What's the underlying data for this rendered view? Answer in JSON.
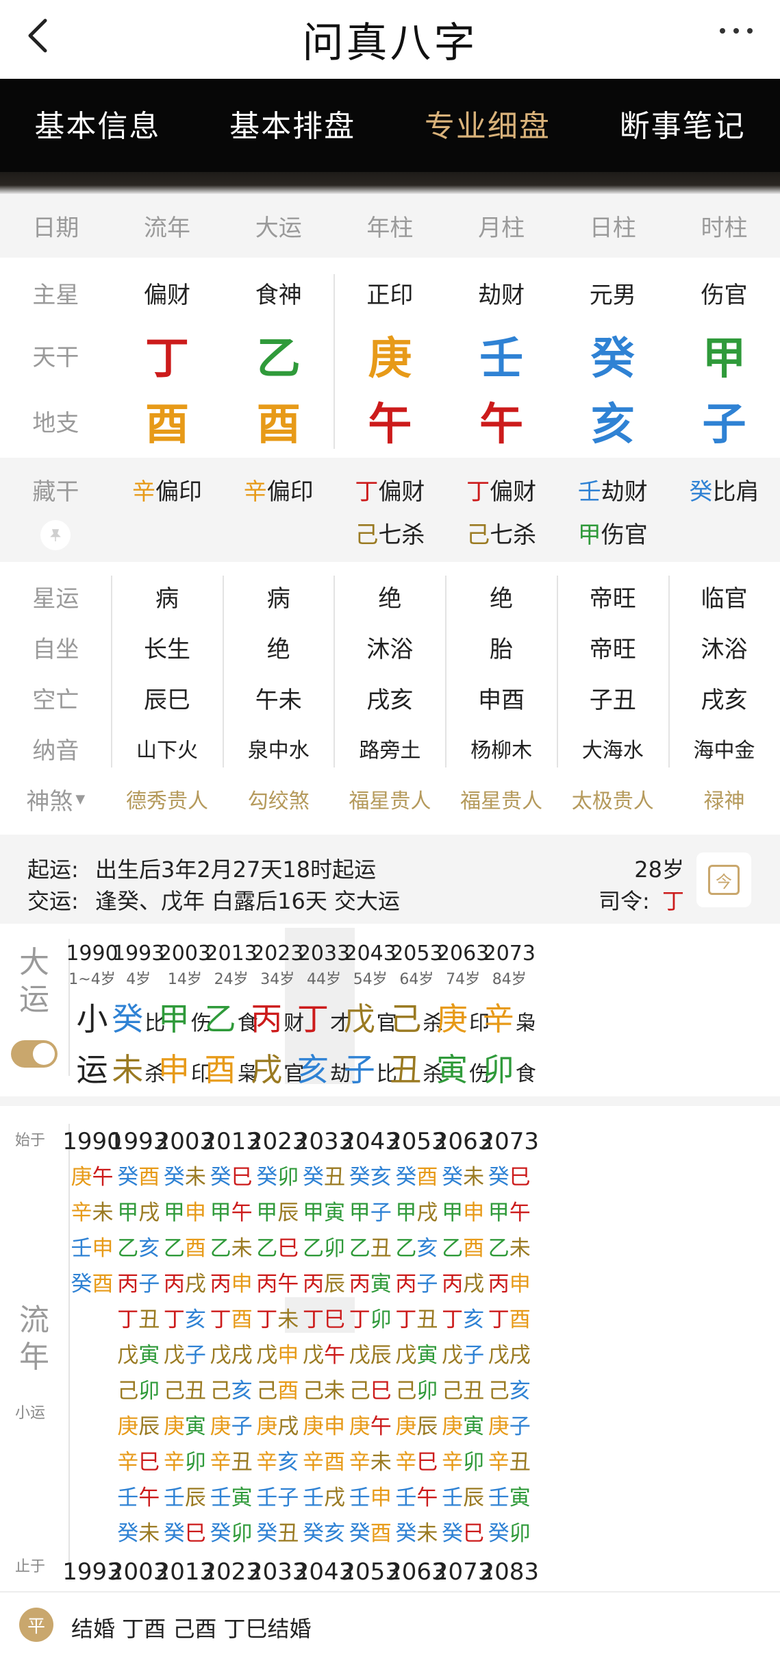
{
  "header": {
    "title": "问真八字"
  },
  "tabs": [
    "基本信息",
    "基本排盘",
    "专业细盘",
    "断事笔记"
  ],
  "columns": [
    "日期",
    "流年",
    "大运",
    "年柱",
    "月柱",
    "日柱",
    "时柱"
  ],
  "rows": {
    "main_star": {
      "label": "主星",
      "values": [
        "偏财",
        "食神",
        "正印",
        "劫财",
        "元男",
        "伤官"
      ]
    },
    "tiangan": {
      "label": "天干",
      "values": [
        "丁",
        "乙",
        "庚",
        "壬",
        "癸",
        "甲"
      ]
    },
    "dizhi": {
      "label": "地支",
      "values": [
        "酉",
        "酉",
        "午",
        "午",
        "亥",
        "子"
      ]
    },
    "canggan": {
      "label": "藏干",
      "items": [
        [
          [
            "辛",
            "偏印"
          ]
        ],
        [
          [
            "辛",
            "偏印"
          ]
        ],
        [
          [
            "丁",
            "偏财"
          ],
          [
            "己",
            "七杀"
          ]
        ],
        [
          [
            "丁",
            "偏财"
          ],
          [
            "己",
            "七杀"
          ]
        ],
        [
          [
            "壬",
            "劫财"
          ],
          [
            "甲",
            "伤官"
          ]
        ],
        [
          [
            "癸",
            "比肩"
          ]
        ]
      ]
    },
    "xingyun": {
      "label": "星运",
      "values": [
        "病",
        "病",
        "绝",
        "绝",
        "帝旺",
        "临官"
      ]
    },
    "zizuo": {
      "label": "自坐",
      "values": [
        "长生",
        "绝",
        "沐浴",
        "胎",
        "帝旺",
        "沐浴"
      ]
    },
    "kongwang": {
      "label": "空亡",
      "values": [
        "辰巳",
        "午未",
        "戌亥",
        "申酉",
        "子丑",
        "戌亥"
      ]
    },
    "nayin": {
      "label": "纳音",
      "values": [
        "山下火",
        "泉中水",
        "路旁土",
        "杨柳木",
        "大海水",
        "海中金"
      ]
    },
    "shensha": {
      "label": "神煞",
      "values": [
        "德秀贵人",
        "勾绞煞",
        "福星贵人",
        "福星贵人",
        "太极贵人",
        "禄神"
      ]
    }
  },
  "qiyun": {
    "label1": "起运:",
    "text1": "出生后3年2月27天18时起运",
    "label2": "交运:",
    "text2": "逢癸、戊年 白露后16天 交大运",
    "age": "28岁",
    "siling_label": "司令:",
    "siling_value": "丁",
    "calendar_icon_text": "今"
  },
  "dayun": {
    "label_top": "大",
    "label_bottom": "运",
    "columns": [
      {
        "year": "1990",
        "age": "1~4岁",
        "top": [
          "小",
          ""
        ],
        "bottom": [
          "运",
          ""
        ]
      },
      {
        "year": "1993",
        "age": "4岁",
        "top": [
          "癸",
          "比"
        ],
        "bottom": [
          "未",
          "杀"
        ]
      },
      {
        "year": "2003",
        "age": "14岁",
        "top": [
          "甲",
          "伤"
        ],
        "bottom": [
          "申",
          "印"
        ]
      },
      {
        "year": "2013",
        "age": "24岁",
        "top": [
          "乙",
          "食"
        ],
        "bottom": [
          "酉",
          "枭"
        ]
      },
      {
        "year": "2023",
        "age": "34岁",
        "top": [
          "丙",
          "财"
        ],
        "bottom": [
          "戌",
          "官"
        ]
      },
      {
        "year": "2033",
        "age": "44岁",
        "top": [
          "丁",
          "才"
        ],
        "bottom": [
          "亥",
          "劫"
        ]
      },
      {
        "year": "2043",
        "age": "54岁",
        "top": [
          "戊",
          "官"
        ],
        "bottom": [
          "子",
          "比"
        ]
      },
      {
        "year": "2053",
        "age": "64岁",
        "top": [
          "己",
          "杀"
        ],
        "bottom": [
          "丑",
          "杀"
        ]
      },
      {
        "year": "2063",
        "age": "74岁",
        "top": [
          "庚",
          "印"
        ],
        "bottom": [
          "寅",
          "伤"
        ]
      },
      {
        "year": "2073",
        "age": "84岁",
        "top": [
          "辛",
          "枭"
        ],
        "bottom": [
          "卯",
          "食"
        ]
      }
    ]
  },
  "liunian": {
    "start_label": "始于",
    "end_label": "止于",
    "side_top": "流",
    "side_bottom": "年",
    "side_small": "小运",
    "columns": [
      {
        "start": "1990",
        "end": "1993",
        "items": [
          "庚午",
          "辛未",
          "壬申",
          "癸酉"
        ]
      },
      {
        "start": "1993",
        "end": "2003",
        "items": [
          "癸酉",
          "甲戌",
          "乙亥",
          "丙子",
          "丁丑",
          "戊寅",
          "己卯",
          "庚辰",
          "辛巳",
          "壬午",
          "癸未"
        ]
      },
      {
        "start": "2003",
        "end": "2013",
        "items": [
          "癸未",
          "甲申",
          "乙酉",
          "丙戌",
          "丁亥",
          "戊子",
          "己丑",
          "庚寅",
          "辛卯",
          "壬辰",
          "癸巳"
        ]
      },
      {
        "start": "2013",
        "end": "2023",
        "items": [
          "癸巳",
          "甲午",
          "乙未",
          "丙申",
          "丁酉",
          "戊戌",
          "己亥",
          "庚子",
          "辛丑",
          "壬寅",
          "癸卯"
        ]
      },
      {
        "start": "2023",
        "end": "2033",
        "items": [
          "癸卯",
          "甲辰",
          "乙巳",
          "丙午",
          "丁未",
          "戊申",
          "己酉",
          "庚戌",
          "辛亥",
          "壬子",
          "癸丑"
        ]
      },
      {
        "start": "2033",
        "end": "2043",
        "items": [
          "癸丑",
          "甲寅",
          "乙卯",
          "丙辰",
          "丁巳",
          "戊午",
          "己未",
          "庚申",
          "辛酉",
          "壬戌",
          "癸亥"
        ]
      },
      {
        "start": "2043",
        "end": "2053",
        "items": [
          "癸亥",
          "甲子",
          "乙丑",
          "丙寅",
          "丁卯",
          "戊辰",
          "己巳",
          "庚午",
          "辛未",
          "壬申",
          "癸酉"
        ]
      },
      {
        "start": "2053",
        "end": "2063",
        "items": [
          "癸酉",
          "甲戌",
          "乙亥",
          "丙子",
          "丁丑",
          "戊寅",
          "己卯",
          "庚辰",
          "辛巳",
          "壬午",
          "癸未"
        ]
      },
      {
        "start": "2063",
        "end": "2073",
        "items": [
          "癸未",
          "甲申",
          "乙酉",
          "丙戌",
          "丁亥",
          "戊子",
          "己丑",
          "庚寅",
          "辛卯",
          "壬辰",
          "癸巳"
        ]
      },
      {
        "start": "2073",
        "end": "2083",
        "items": [
          "癸巳",
          "甲午",
          "乙未",
          "丙申",
          "丁酉",
          "戊戌",
          "己亥",
          "庚子",
          "辛丑",
          "壬寅",
          "癸卯"
        ]
      }
    ]
  },
  "note": {
    "badge": "平",
    "text": "结婚 丁酉 己酉 丁巳结婚"
  },
  "colors": {
    "fire": "#cc1b1b",
    "wood": "#2f9a3a",
    "earth_bright": "#e79a18",
    "water": "#2f82d4",
    "earth_dark": "#9a7a22",
    "gold_text": "#b59a5c",
    "tab_active": "#d9b27a",
    "tab_bar": "#070707"
  }
}
